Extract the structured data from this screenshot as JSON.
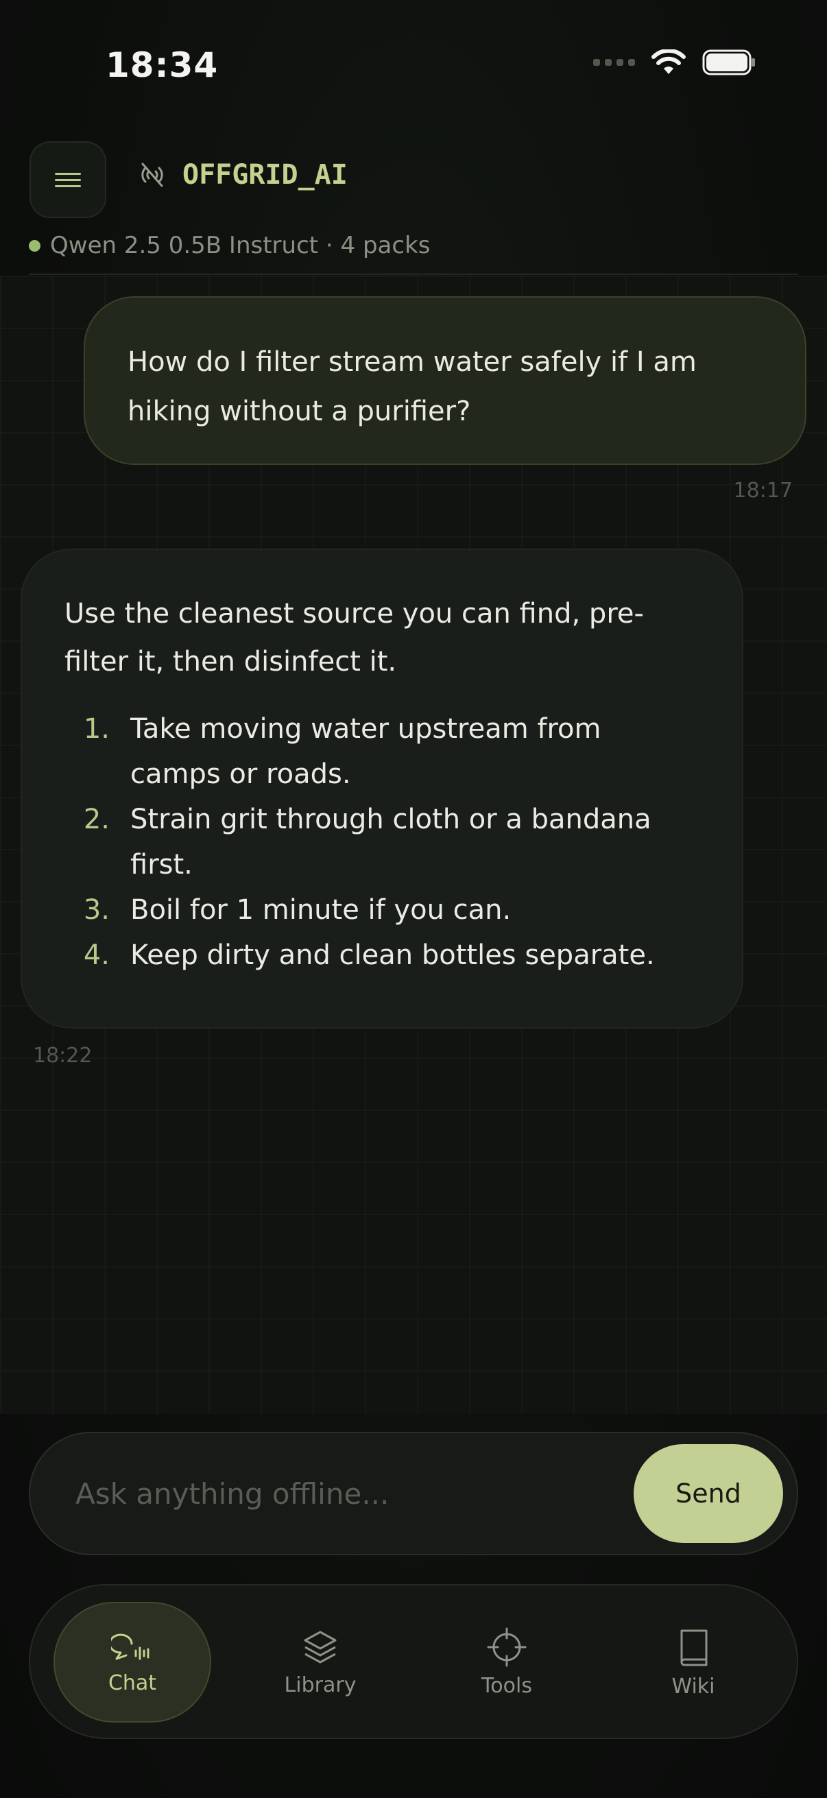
{
  "status_bar": {
    "time": "18:34"
  },
  "header": {
    "menu_icon": "hamburger-icon",
    "offline_icon": "offline-signal-icon",
    "title": "OFFGRID_AI",
    "model_line": "Qwen 2.5 0.5B Instruct · 4 packs",
    "status_color": "#9bbd6e"
  },
  "messages": [
    {
      "role": "user",
      "text": "How do I filter stream water safely if I am hiking without a purifier?",
      "time": "18:17"
    },
    {
      "role": "assistant",
      "intro": "Use the cleanest source you can find, pre-filter it, then disinfect it.",
      "steps": [
        {
          "num": "1.",
          "text": "Take moving water upstream from camps or roads."
        },
        {
          "num": "2.",
          "text": "Strain grit through cloth or a bandana first."
        },
        {
          "num": "3.",
          "text": "Boil for 1 minute if you can."
        },
        {
          "num": "4.",
          "text": "Keep dirty and clean bottles separate."
        }
      ],
      "time": "18:22"
    }
  ],
  "composer": {
    "placeholder": "Ask anything offline...",
    "send_label": "Send"
  },
  "tabs": [
    {
      "label": "Chat",
      "icon": "chat-voice-icon",
      "active": true
    },
    {
      "label": "Library",
      "icon": "layers-icon",
      "active": false
    },
    {
      "label": "Tools",
      "icon": "crosshair-icon",
      "active": false
    },
    {
      "label": "Wiki",
      "icon": "book-icon",
      "active": false
    }
  ],
  "colors": {
    "accent": "#c3d093",
    "accent_text": "#c5d18f",
    "background": "#0c0e0c",
    "user_bubble": "#23281c",
    "assistant_bubble": "#1a1e1a"
  }
}
